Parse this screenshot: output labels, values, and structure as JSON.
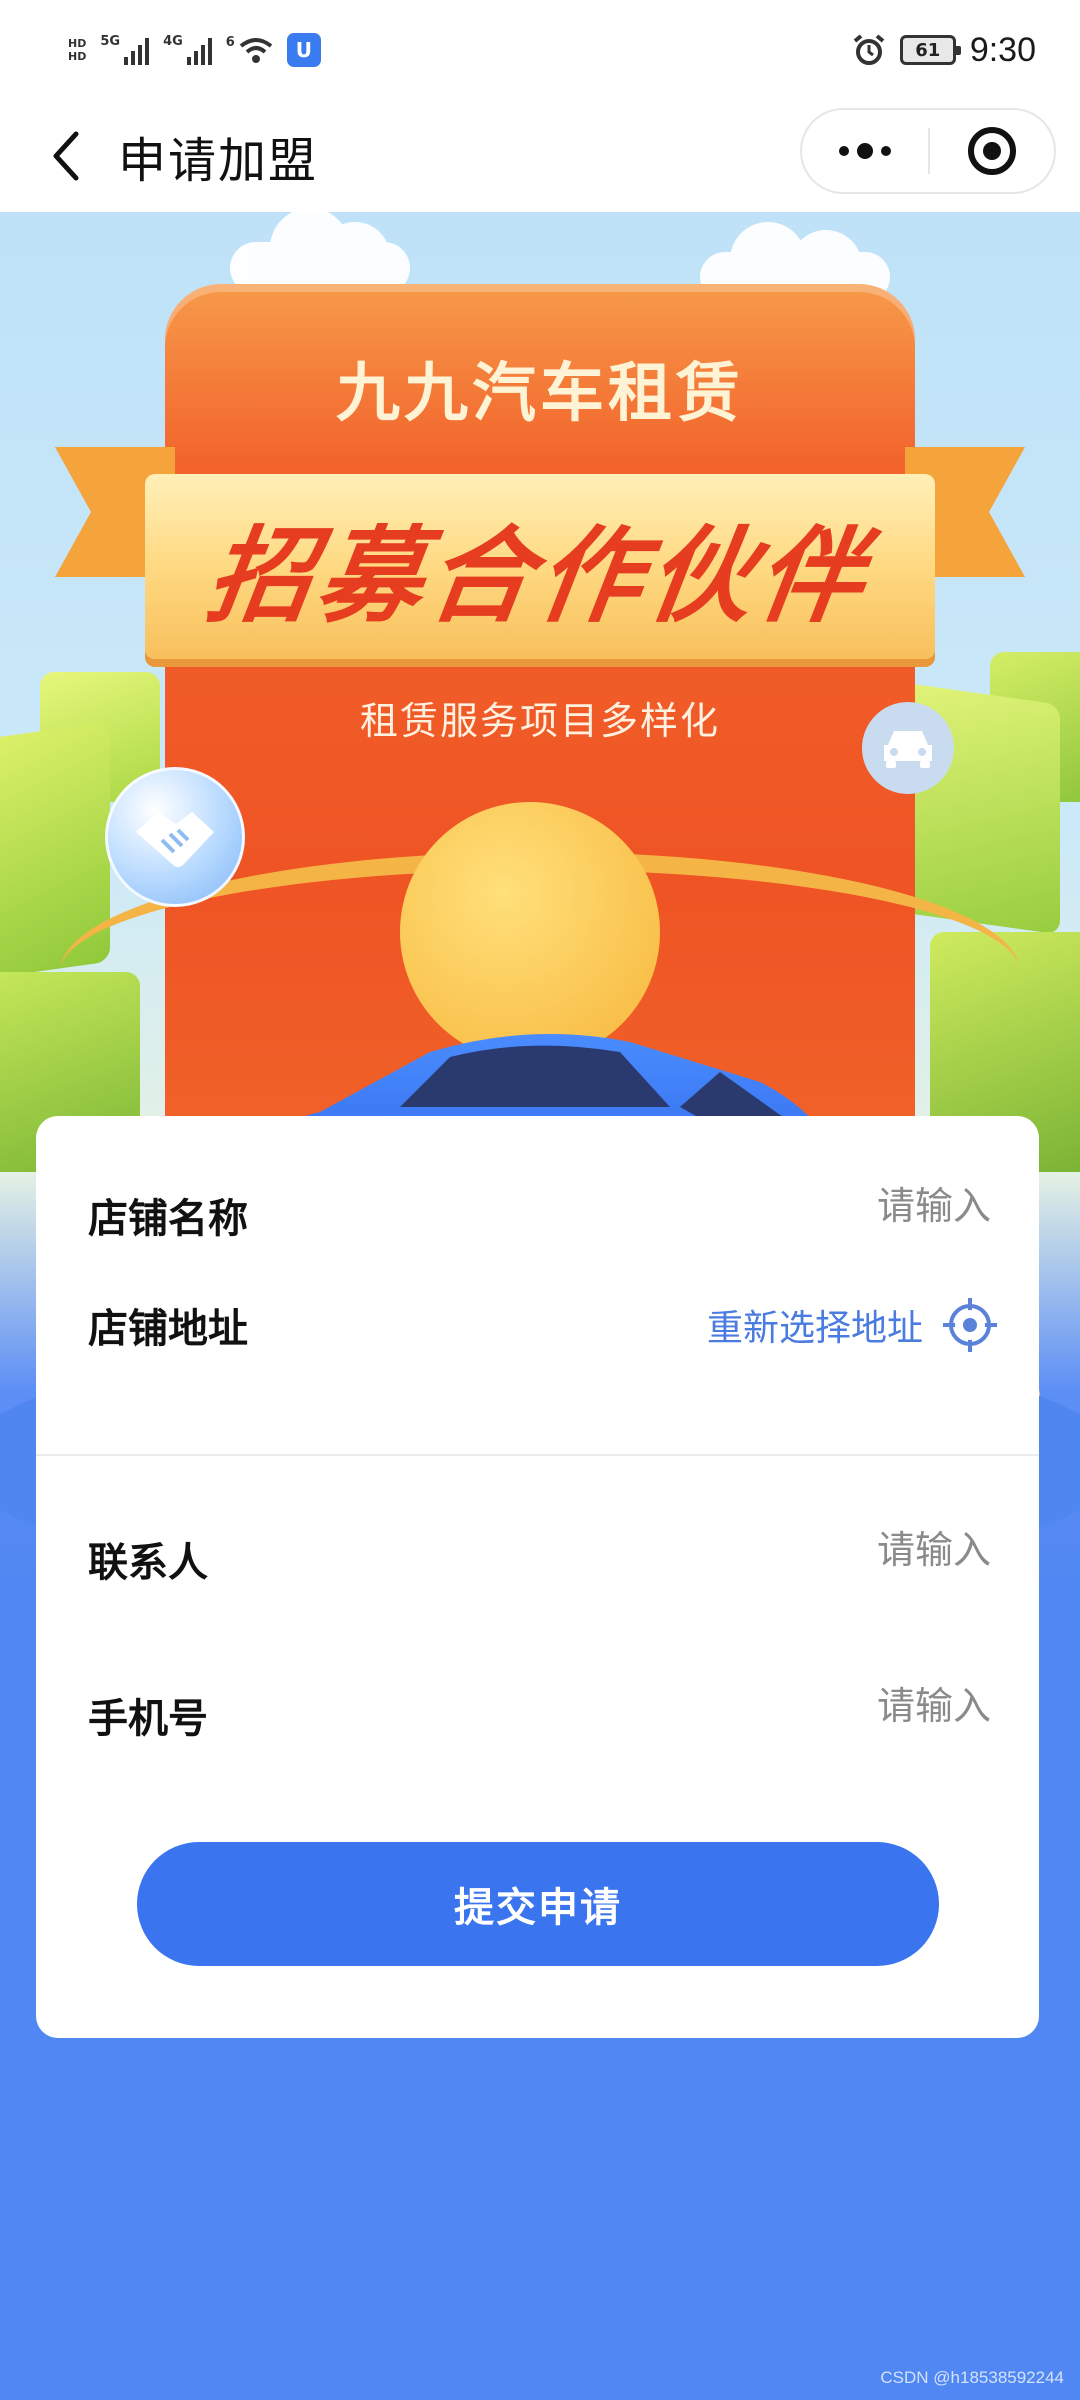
{
  "status_bar": {
    "hd_top": "HD",
    "hd_bottom": "HD",
    "network_1": "5G",
    "network_2": "4G",
    "wifi_label": "6",
    "app_badge": "U",
    "battery": "61",
    "time": "9:30"
  },
  "nav": {
    "title": "申请加盟",
    "back_icon": "chevron-left-icon",
    "more_icon": "more-dots-icon",
    "close_icon": "target-circle-icon"
  },
  "banner": {
    "brand": "九九汽车租赁",
    "headline": "招募合作伙伴",
    "subtitle": "租赁服务项目多样化",
    "icons": [
      "handshake-icon",
      "car-icon"
    ]
  },
  "form": {
    "shop_name": {
      "label": "店铺名称",
      "placeholder": "请输入"
    },
    "shop_address": {
      "label": "店铺地址",
      "action": "重新选择地址",
      "icon": "locate-icon"
    },
    "contact": {
      "label": "联系人",
      "placeholder": "请输入"
    },
    "phone": {
      "label": "手机号",
      "placeholder": "请输入"
    },
    "submit_label": "提交申请"
  },
  "watermark": "CSDN @h18538592244",
  "colors": {
    "primary": "#3b74ef",
    "page_background": "#5187f2",
    "sign_orange": "#ef5424",
    "headline_red": "#e63c1f",
    "link_blue": "#4a7be0"
  }
}
